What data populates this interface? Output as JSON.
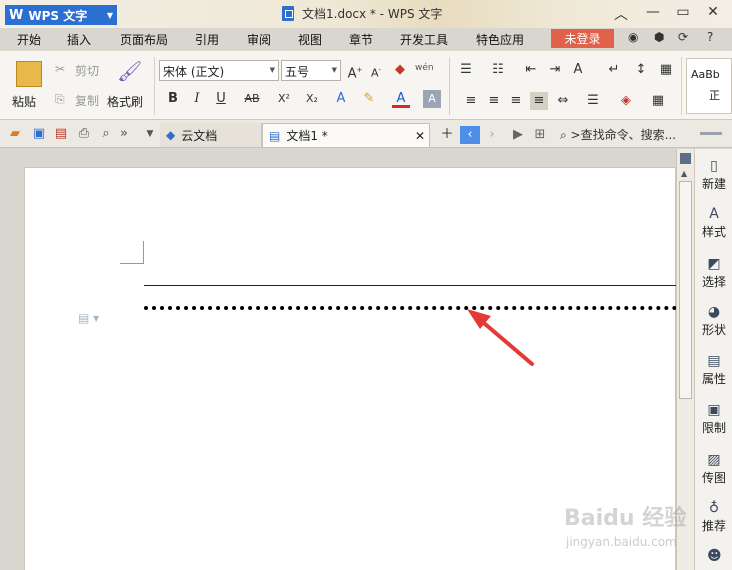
{
  "app": {
    "name": "WPS 文字",
    "logo": "W"
  },
  "window": {
    "title": "文档1.docx * - WPS 文字",
    "controls": [
      "chevron-up-icon",
      "minimize-icon",
      "restore-icon",
      "close-icon"
    ]
  },
  "menu": {
    "items": [
      "开始",
      "插入",
      "页面布局",
      "引用",
      "审阅",
      "视图",
      "章节",
      "开发工具",
      "特色应用"
    ],
    "login": "未登录",
    "help": "?"
  },
  "ribbon": {
    "paste": "粘贴",
    "cut": "剪切",
    "copy": "复制",
    "format_painter": "格式刷",
    "font_name": "宋体 (正文)",
    "font_size": "五号",
    "bold": "B",
    "italic": "I",
    "underline": "U",
    "strike": "AB",
    "superscript": "X²",
    "subscript": "X₂",
    "style_preview": "AaBb",
    "style_name": "正"
  },
  "tabs": {
    "cloud": "云文档",
    "doc": "文档1 *",
    "search": ">查找命令、搜索..."
  },
  "side_panel": {
    "items": [
      {
        "label": "新建",
        "icon": "new-doc-icon"
      },
      {
        "label": "样式",
        "icon": "style-icon"
      },
      {
        "label": "选择",
        "icon": "select-icon"
      },
      {
        "label": "形状",
        "icon": "shape-icon"
      },
      {
        "label": "属性",
        "icon": "property-icon"
      },
      {
        "label": "限制",
        "icon": "restrict-icon"
      },
      {
        "label": "传图",
        "icon": "upload-image-icon"
      },
      {
        "label": "推荐",
        "icon": "recommend-icon"
      }
    ]
  },
  "watermark": {
    "main": "Baidu 经验",
    "sub": "jingyan.baidu.com"
  },
  "colors": {
    "accent": "#2b6fd0",
    "login": "#e0624a",
    "arrow": "#e53935"
  }
}
